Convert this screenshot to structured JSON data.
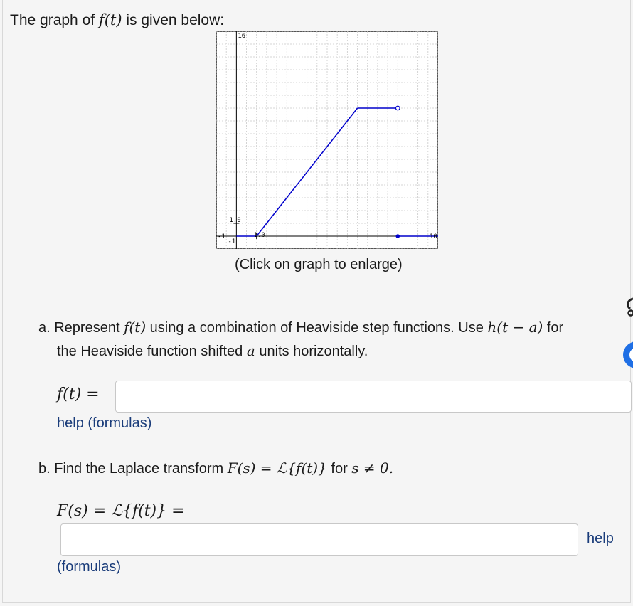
{
  "intro": {
    "prefix": "The graph of ",
    "func": "f(t)",
    "suffix": " is given below:"
  },
  "graph": {
    "x_min_label": "-1",
    "x_max_label": "10",
    "y_min_label": "-1",
    "y_max_label": "16",
    "x_tick_label": "1.0",
    "y_tick_label": "1.0",
    "curve_color": "#0000cc"
  },
  "chart_data": {
    "type": "line",
    "xlim": [
      -1,
      10
    ],
    "ylim": [
      -1,
      16
    ],
    "segments": [
      {
        "x": [
          0,
          1
        ],
        "y": [
          0,
          0
        ]
      },
      {
        "x": [
          1,
          6
        ],
        "y": [
          0,
          10
        ]
      },
      {
        "x": [
          6,
          8
        ],
        "y": [
          10,
          10
        ],
        "end": "open"
      },
      {
        "x": [
          8,
          10
        ],
        "y": [
          0,
          0
        ],
        "start": "closed"
      }
    ],
    "grid": true
  },
  "caption": "(Click on graph to enlarge)",
  "part_a": {
    "p1": "a. Represent ",
    "func": "f(t)",
    "p2": " using a combination of Heaviside step functions. Use ",
    "h": "h(t − a)",
    "p3": " for",
    "p4": "the Heaviside function shifted ",
    "a": "a",
    "p5": " units horizontally.",
    "label": "f(t) =",
    "input_value": "",
    "help": "help (formulas)"
  },
  "part_b": {
    "p1": "b. Find the Laplace transform ",
    "eq": "F(s) = ℒ{f(t)}",
    "p2": " for ",
    "cond": "s ≠ 0.",
    "label": "F(s) = ℒ{f(t)} =",
    "input_value": "",
    "help": "help",
    "formulas": "(formulas)"
  }
}
